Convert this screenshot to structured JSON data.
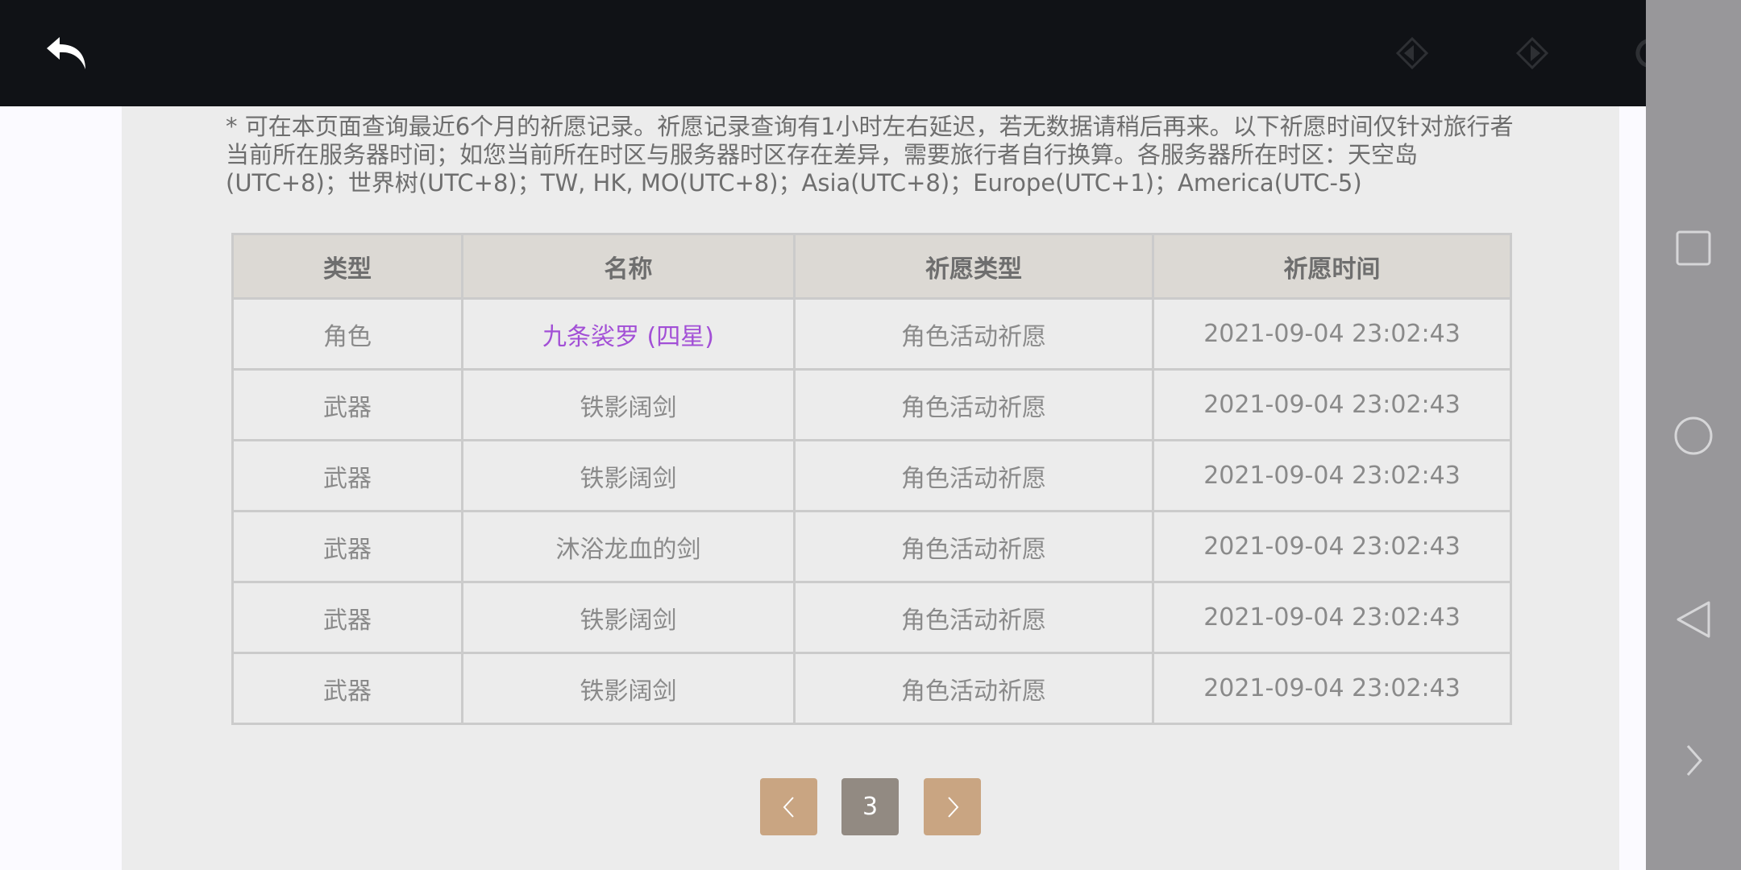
{
  "topbar": {
    "back_icon": "back-arrow-icon",
    "prev_icon": "prev-diamond-icon",
    "next_icon": "next-diamond-icon",
    "refresh_icon": "refresh-icon"
  },
  "notice": "* 可在本页面查询最近6个月的祈愿记录。祈愿记录查询有1小时左右延迟，若无数据请稍后再来。以下祈愿时间仅针对旅行者当前所在服务器时间；如您当前所在时区与服务器时区存在差异，需要旅行者自行换算。各服务器所在时区：天空岛(UTC+8)；世界树(UTC+8)；TW, HK, MO(UTC+8)；Asia(UTC+8)；Europe(UTC+1)；America(UTC-5)",
  "table": {
    "headers": {
      "type": "类型",
      "name": "名称",
      "wish_type": "祈愿类型",
      "time": "祈愿时间"
    },
    "rows": [
      {
        "type": "角色",
        "name": "九条裟罗 (四星)",
        "wish_type": "角色活动祈愿",
        "time": "2021-09-04 23:02:43"
      },
      {
        "type": "武器",
        "name": "铁影阔剑",
        "wish_type": "角色活动祈愿",
        "time": "2021-09-04 23:02:43"
      },
      {
        "type": "武器",
        "name": "铁影阔剑",
        "wish_type": "角色活动祈愿",
        "time": "2021-09-04 23:02:43"
      },
      {
        "type": "武器",
        "name": "沐浴龙血的剑",
        "wish_type": "角色活动祈愿",
        "time": "2021-09-04 23:02:43"
      },
      {
        "type": "武器",
        "name": "铁影阔剑",
        "wish_type": "角色活动祈愿",
        "time": "2021-09-04 23:02:43"
      },
      {
        "type": "武器",
        "name": "铁影阔剑",
        "wish_type": "角色活动祈愿",
        "time": "2021-09-04 23:02:43"
      }
    ]
  },
  "pagination": {
    "current_page": "3",
    "prev_icon": "chevron-left-icon",
    "next_icon": "chevron-right-icon"
  },
  "navbar": {
    "recents_icon": "square-icon",
    "home_icon": "circle-icon",
    "back_icon": "triangle-back-icon",
    "expand_icon": "chevron-right-icon"
  },
  "colors": {
    "four_star": "#a24fd6",
    "header_bg": "#dcd9d4",
    "page_btn": "#c9a582",
    "page_current": "#928a82"
  }
}
